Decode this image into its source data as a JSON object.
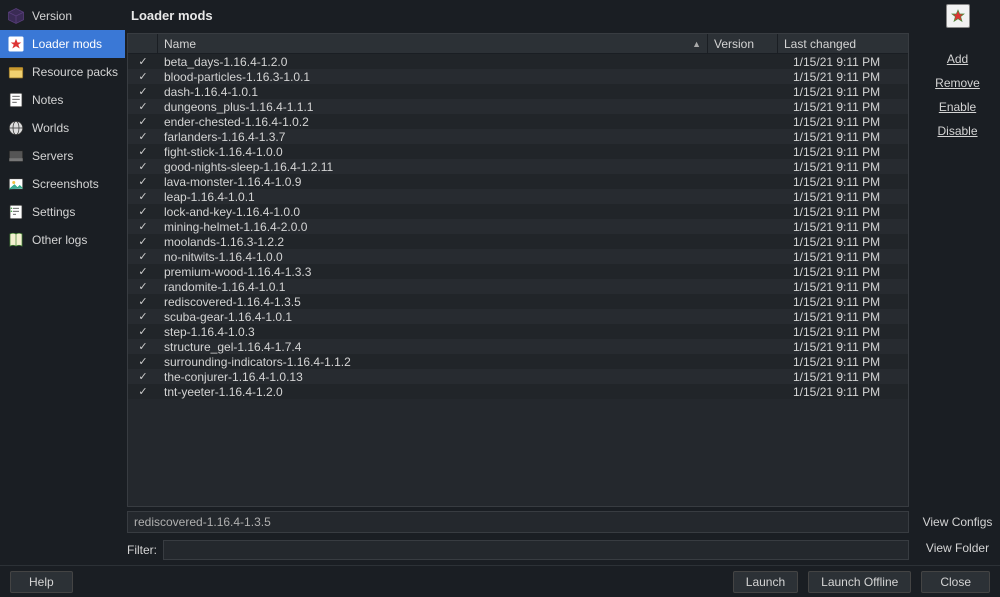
{
  "page": {
    "title": "Loader mods"
  },
  "sidebar": {
    "items": [
      {
        "id": "sidebar-item-version",
        "label": "Version"
      },
      {
        "id": "sidebar-item-loader-mods",
        "label": "Loader mods"
      },
      {
        "id": "sidebar-item-resource-packs",
        "label": "Resource packs"
      },
      {
        "id": "sidebar-item-notes",
        "label": "Notes"
      },
      {
        "id": "sidebar-item-worlds",
        "label": "Worlds"
      },
      {
        "id": "sidebar-item-servers",
        "label": "Servers"
      },
      {
        "id": "sidebar-item-screenshots",
        "label": "Screenshots"
      },
      {
        "id": "sidebar-item-settings",
        "label": "Settings"
      },
      {
        "id": "sidebar-item-other-logs",
        "label": "Other logs"
      }
    ],
    "activeIndex": 1
  },
  "table": {
    "columns": {
      "name": "Name",
      "version": "Version",
      "changed": "Last changed"
    },
    "check_glyph": "✓",
    "rows": [
      {
        "name": "beta_days-1.16.4-1.2.0",
        "changed": "1/15/21 9:11 PM"
      },
      {
        "name": "blood-particles-1.16.3-1.0.1",
        "changed": "1/15/21 9:11 PM"
      },
      {
        "name": "dash-1.16.4-1.0.1",
        "changed": "1/15/21 9:11 PM"
      },
      {
        "name": "dungeons_plus-1.16.4-1.1.1",
        "changed": "1/15/21 9:11 PM"
      },
      {
        "name": "ender-chested-1.16.4-1.0.2",
        "changed": "1/15/21 9:11 PM"
      },
      {
        "name": "farlanders-1.16.4-1.3.7",
        "changed": "1/15/21 9:11 PM"
      },
      {
        "name": "fight-stick-1.16.4-1.0.0",
        "changed": "1/15/21 9:11 PM"
      },
      {
        "name": "good-nights-sleep-1.16.4-1.2.11",
        "changed": "1/15/21 9:11 PM"
      },
      {
        "name": "lava-monster-1.16.4-1.0.9",
        "changed": "1/15/21 9:11 PM"
      },
      {
        "name": "leap-1.16.4-1.0.1",
        "changed": "1/15/21 9:11 PM"
      },
      {
        "name": "lock-and-key-1.16.4-1.0.0",
        "changed": "1/15/21 9:11 PM"
      },
      {
        "name": "mining-helmet-1.16.4-2.0.0",
        "changed": "1/15/21 9:11 PM"
      },
      {
        "name": "moolands-1.16.3-1.2.2",
        "changed": "1/15/21 9:11 PM"
      },
      {
        "name": "no-nitwits-1.16.4-1.0.0",
        "changed": "1/15/21 9:11 PM"
      },
      {
        "name": "premium-wood-1.16.4-1.3.3",
        "changed": "1/15/21 9:11 PM"
      },
      {
        "name": "randomite-1.16.4-1.0.1",
        "changed": "1/15/21 9:11 PM"
      },
      {
        "name": "rediscovered-1.16.4-1.3.5",
        "changed": "1/15/21 9:11 PM"
      },
      {
        "name": "scuba-gear-1.16.4-1.0.1",
        "changed": "1/15/21 9:11 PM"
      },
      {
        "name": "step-1.16.4-1.0.3",
        "changed": "1/15/21 9:11 PM"
      },
      {
        "name": "structure_gel-1.16.4-1.7.4",
        "changed": "1/15/21 9:11 PM"
      },
      {
        "name": "surrounding-indicators-1.16.4-1.1.2",
        "changed": "1/15/21 9:11 PM"
      },
      {
        "name": "the-conjurer-1.16.4-1.0.13",
        "changed": "1/15/21 9:11 PM"
      },
      {
        "name": "tnt-yeeter-1.16.4-1.2.0",
        "changed": "1/15/21 9:11 PM"
      }
    ]
  },
  "status": {
    "text": "rediscovered-1.16.4-1.3.5"
  },
  "filter": {
    "label": "Filter:",
    "value": ""
  },
  "actions": {
    "add": "Add",
    "remove": "Remove",
    "enable": "Enable",
    "disable": "Disable",
    "view_configs": "View Configs",
    "view_folder": "View Folder"
  },
  "buttons": {
    "help": "Help",
    "launch": "Launch",
    "launch_offline": "Launch Offline",
    "close": "Close"
  }
}
